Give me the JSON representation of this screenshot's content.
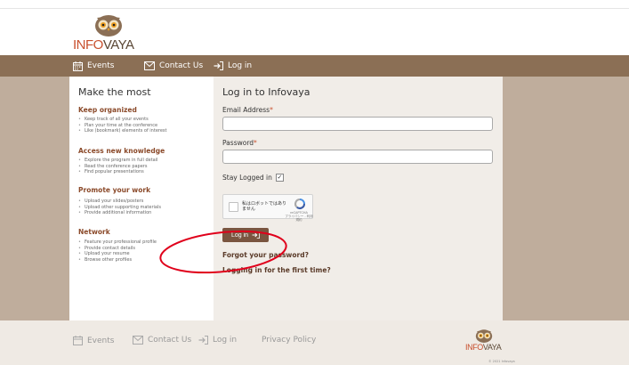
{
  "brand": {
    "name_part1": "INFO",
    "name_part2": "VAYA"
  },
  "nav": {
    "events": "Events",
    "contact": "Contact Us",
    "login": "Log in"
  },
  "left": {
    "title": "Make the most",
    "sections": [
      {
        "heading": "Keep organized",
        "items": [
          "Keep track of all your events",
          "Plan your time at the conference",
          "Like (bookmark) elements of interest"
        ]
      },
      {
        "heading": "Access new knowledge",
        "items": [
          "Explore the program in full detail",
          "Read the conference papers",
          "Find popular presentations"
        ]
      },
      {
        "heading": "Promote your work",
        "items": [
          "Upload your slides/posters",
          "Upload other supporting materials",
          "Provide additional information"
        ]
      },
      {
        "heading": "Network",
        "items": [
          "Feature your professional profile",
          "Provide contact details",
          "Upload your resume",
          "Browse other profiles"
        ]
      }
    ]
  },
  "login": {
    "title": "Log in to Infovaya",
    "email_label": "Email Address",
    "email_value": "",
    "password_label": "Password",
    "password_value": "",
    "required_mark": "*",
    "stay_label": "Stay Logged in",
    "stay_checked": "✓",
    "captcha_text": "私はロボットではありません",
    "captcha_brand": "reCAPTCHA",
    "captcha_links": "プライバシー - 利用規約",
    "button": "Log in",
    "forgot": "Forgot your password?",
    "first_time": "Logging in for the first time?"
  },
  "footer": {
    "events": "Events",
    "contact": "Contact Us",
    "login": "Log in",
    "privacy": "Privacy Policy",
    "copyright": "© 2021 Infovaya"
  },
  "colors": {
    "nav_bg": "#8b6f55",
    "main_bg": "#bfad9c",
    "accent": "#c8502e",
    "button_bg": "#7a5540",
    "annotation": "#e0001b"
  },
  "icons": {
    "events": "calendar-icon",
    "contact": "envelope-icon",
    "login": "login-arrow-icon"
  }
}
